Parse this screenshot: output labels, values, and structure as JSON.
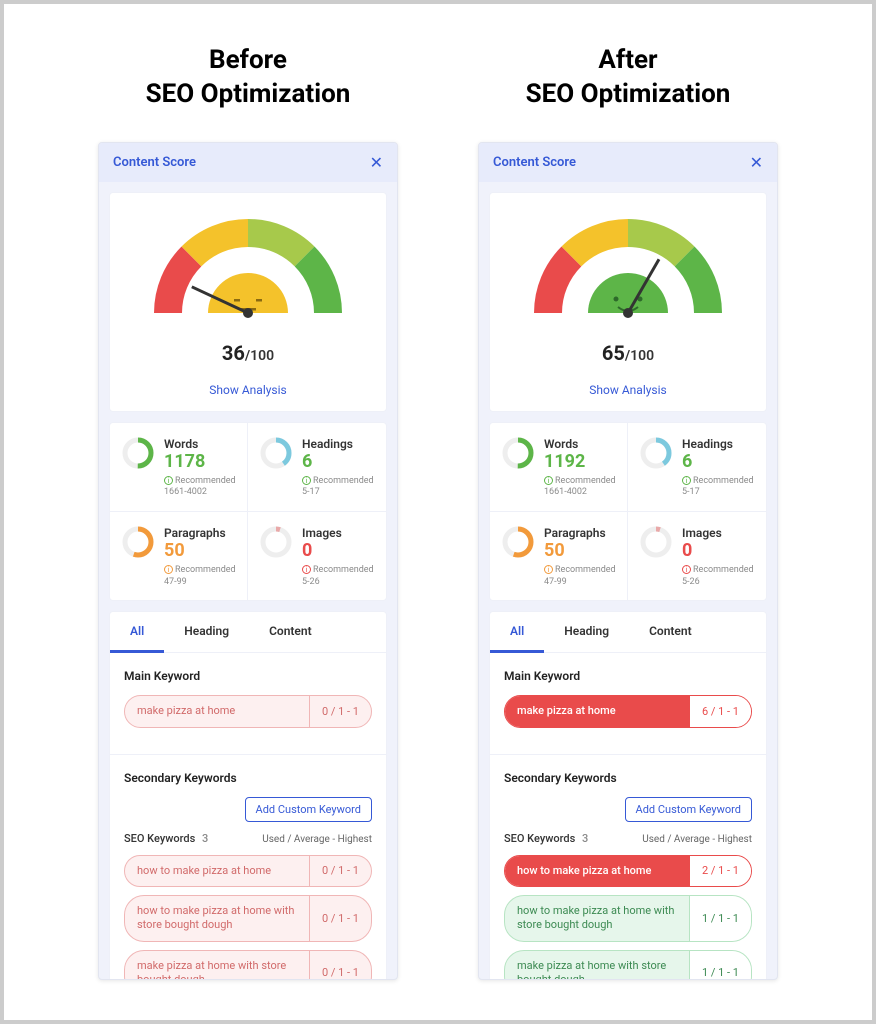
{
  "before": {
    "title": "Before\nSEO Optimization",
    "panel_title": "Content Score",
    "score": "36",
    "score_denom": "/100",
    "show_analysis": "Show Analysis",
    "gauge_needle_angle": -65,
    "gauge_face": "neutral",
    "stats": {
      "words": {
        "label": "Words",
        "value": "1178",
        "range": "1661-4002",
        "rec": "Recommended",
        "color": "green",
        "donut_color": "#5db548",
        "donut_frac": 0.5
      },
      "headings": {
        "label": "Headings",
        "value": "6",
        "range": "5-17",
        "rec": "Recommended",
        "color": "green",
        "donut_color": "#7cc9de",
        "donut_frac": 0.4
      },
      "paragraphs": {
        "label": "Paragraphs",
        "value": "50",
        "range": "47-99",
        "rec": "Recommended",
        "color": "orange",
        "donut_color": "#f29a3b",
        "donut_frac": 0.55
      },
      "images": {
        "label": "Images",
        "value": "0",
        "range": "5-26",
        "rec": "Recommended",
        "color": "red",
        "donut_color": "#e9a8a8",
        "donut_frac": 0.05
      }
    },
    "tabs": {
      "all": "All",
      "heading": "Heading",
      "content": "Content"
    },
    "main_keyword_label": "Main Keyword",
    "main_keyword": {
      "text": "make pizza at home",
      "stat": "0 / 1 - 1",
      "style": "red-light"
    },
    "secondary_label": "Secondary Keywords",
    "add_custom": "Add Custom Keyword",
    "seo_kw_label": "SEO Keywords",
    "seo_kw_count": "3",
    "seo_kw_legend": "Used / Average - Highest",
    "secondary_keywords": [
      {
        "text": "how to make pizza at home",
        "stat": "0 / 1 - 1",
        "style": "red-light"
      },
      {
        "text": "how to make pizza at home with store bought dough",
        "stat": "0 / 1 - 1",
        "style": "red-light"
      },
      {
        "text": "make pizza at home with store bought dough",
        "stat": "0 / 1 - 1",
        "style": "red-light"
      }
    ]
  },
  "after": {
    "title": "After\nSEO Optimization",
    "panel_title": "Content Score",
    "score": "65",
    "score_denom": "/100",
    "show_analysis": "Show Analysis",
    "gauge_needle_angle": 30,
    "gauge_face": "happy",
    "stats": {
      "words": {
        "label": "Words",
        "value": "1192",
        "range": "1661-4002",
        "rec": "Recommended",
        "color": "green",
        "donut_color": "#5db548",
        "donut_frac": 0.5
      },
      "headings": {
        "label": "Headings",
        "value": "6",
        "range": "5-17",
        "rec": "Recommended",
        "color": "green",
        "donut_color": "#7cc9de",
        "donut_frac": 0.4
      },
      "paragraphs": {
        "label": "Paragraphs",
        "value": "50",
        "range": "47-99",
        "rec": "Recommended",
        "color": "orange",
        "donut_color": "#f29a3b",
        "donut_frac": 0.55
      },
      "images": {
        "label": "Images",
        "value": "0",
        "range": "5-26",
        "rec": "Recommended",
        "color": "red",
        "donut_color": "#e9a8a8",
        "donut_frac": 0.05
      }
    },
    "tabs": {
      "all": "All",
      "heading": "Heading",
      "content": "Content"
    },
    "main_keyword_label": "Main Keyword",
    "main_keyword": {
      "text": "make pizza at home",
      "stat": "6 / 1 - 1",
      "style": "red-fill"
    },
    "secondary_label": "Secondary Keywords",
    "add_custom": "Add Custom Keyword",
    "seo_kw_label": "SEO Keywords",
    "seo_kw_count": "3",
    "seo_kw_legend": "Used / Average - Highest",
    "secondary_keywords": [
      {
        "text": "how to make pizza at home",
        "stat": "2 / 1 - 1",
        "style": "red-fill"
      },
      {
        "text": "how to make pizza at home with store bought dough",
        "stat": "1 / 1 - 1",
        "style": "green-light"
      },
      {
        "text": "make pizza at home with store bought dough",
        "stat": "1 / 1 - 1",
        "style": "green-light"
      }
    ]
  }
}
